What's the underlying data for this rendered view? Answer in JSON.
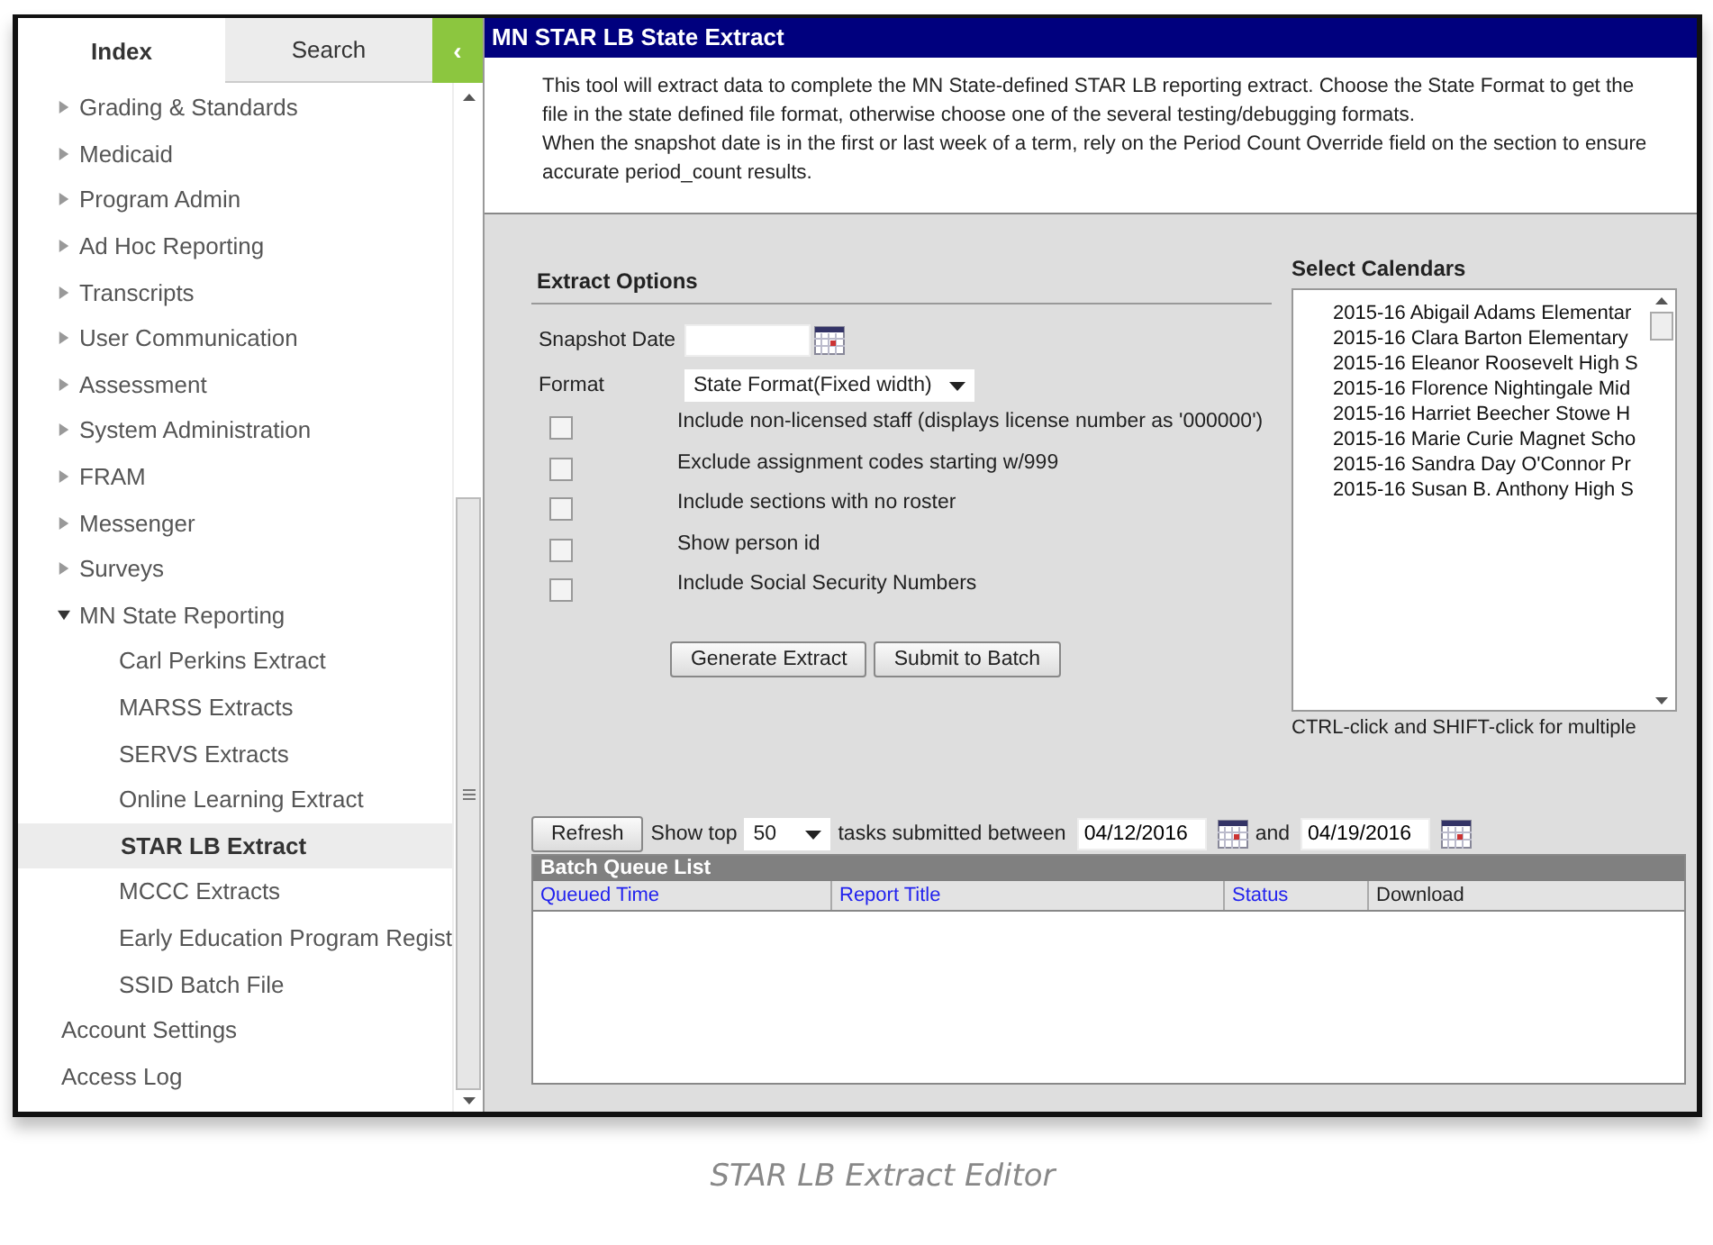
{
  "sidebar": {
    "tabs": [
      {
        "label": "Index",
        "selected": true
      },
      {
        "label": "Search",
        "selected": false
      }
    ],
    "collapse_icon": "‹",
    "items": [
      {
        "kind": "folder",
        "label": "Grading & Standards",
        "expanded": false,
        "selected": false
      },
      {
        "kind": "folder",
        "label": "Medicaid",
        "expanded": false,
        "selected": false
      },
      {
        "kind": "folder",
        "label": "Program Admin",
        "expanded": false,
        "selected": false
      },
      {
        "kind": "folder",
        "label": "Ad Hoc Reporting",
        "expanded": false,
        "selected": false
      },
      {
        "kind": "folder",
        "label": "Transcripts",
        "expanded": false,
        "selected": false
      },
      {
        "kind": "folder",
        "label": "User Communication",
        "expanded": false,
        "selected": false
      },
      {
        "kind": "folder",
        "label": "Assessment",
        "expanded": false,
        "selected": false
      },
      {
        "kind": "folder",
        "label": "System Administration",
        "expanded": false,
        "selected": false
      },
      {
        "kind": "folder",
        "label": "FRAM",
        "expanded": false,
        "selected": false
      },
      {
        "kind": "folder",
        "label": "Messenger",
        "expanded": false,
        "selected": false
      },
      {
        "kind": "folder",
        "label": "Surveys",
        "expanded": false,
        "selected": false
      },
      {
        "kind": "folder",
        "label": "MN State Reporting",
        "expanded": true,
        "selected": false,
        "children": [
          {
            "label": "Carl Perkins Extract",
            "selected": false
          },
          {
            "label": "MARSS Extracts",
            "selected": false
          },
          {
            "label": "SERVS Extracts",
            "selected": false
          },
          {
            "label": "Online Learning Extract",
            "selected": false
          },
          {
            "label": "STAR LB Extract",
            "selected": true
          },
          {
            "label": "MCCC Extracts",
            "selected": false
          },
          {
            "label": "Early Education Program Regist",
            "selected": false
          },
          {
            "label": "SSID Batch File",
            "selected": false
          }
        ]
      },
      {
        "kind": "link",
        "label": "Account Settings",
        "selected": false
      },
      {
        "kind": "link",
        "label": "Access Log",
        "selected": false
      }
    ]
  },
  "main": {
    "title": "MN STAR LB State Extract",
    "description": [
      "This tool will extract data to complete the MN State-defined STAR LB reporting extract. Choose the State Format to get the file in the state defined file format, otherwise choose one of the several testing/debugging formats.",
      "When the snapshot date is in the first or last week of a term, rely on the Period Count Override field on the section to ensure accurate period_count results."
    ],
    "extract_options": {
      "heading": "Extract Options",
      "snapshot_label": "Snapshot Date",
      "format_label": "Format",
      "format_value": "State Format(Fixed width)",
      "options": [
        {
          "label": "Include non-licensed staff (displays license number as '000000')",
          "checked": false
        },
        {
          "label": "Exclude assignment codes starting w/999",
          "checked": false
        },
        {
          "label": "Include sections with no roster",
          "checked": false
        },
        {
          "label": "Show person id",
          "checked": false
        },
        {
          "label": "Include Social Security Numbers",
          "checked": false
        }
      ],
      "buttons": [
        "Generate Extract",
        "Submit to Batch"
      ]
    },
    "calendars": {
      "heading": "Select Calendars",
      "items": [
        {
          "label": "2015-16 Abigail Adams Elementar",
          "selected": false
        },
        {
          "label": "2015-16 Clara Barton Elementary",
          "selected": false
        },
        {
          "label": "2015-16 Eleanor Roosevelt High S",
          "selected": false
        },
        {
          "label": "2015-16 Florence Nightingale Mid",
          "selected": false
        },
        {
          "label": "2015-16 Harriet Beecher Stowe H",
          "selected": false
        },
        {
          "label": "2015-16 Marie Curie Magnet Scho",
          "selected": false
        },
        {
          "label": "2015-16 Sandra Day O'Connor Pr",
          "selected": false
        },
        {
          "label": "2015-16 Susan B. Anthony High S",
          "selected": false
        }
      ],
      "hint": "CTRL-click and SHIFT-click for multiple"
    },
    "batch": {
      "refresh": "Refresh",
      "show_top": "Show top",
      "top_value": "50",
      "between": "tasks submitted between",
      "start_date": "04/12/2016",
      "and": "and",
      "end_date": "04/19/2016",
      "list_title": "Batch Queue List",
      "columns": [
        {
          "label": "Queued Time",
          "sortable": true
        },
        {
          "label": "Report Title",
          "sortable": true
        },
        {
          "label": "Status",
          "sortable": true
        },
        {
          "label": "Download",
          "sortable": false
        }
      ]
    }
  },
  "caption": "STAR LB Extract Editor"
}
